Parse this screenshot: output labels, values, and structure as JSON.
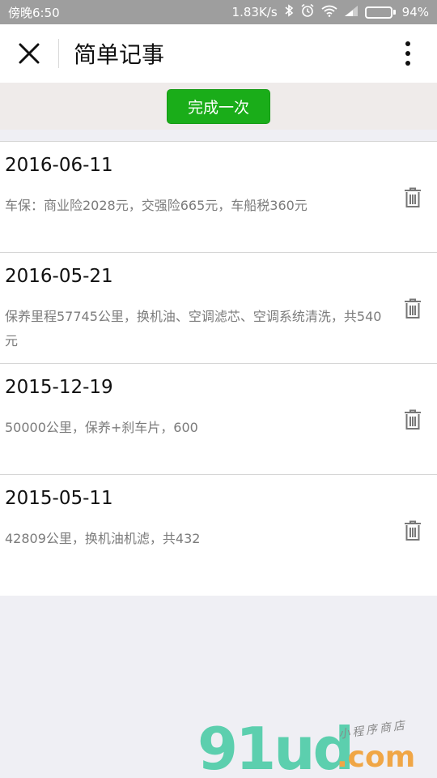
{
  "status_bar": {
    "time": "傍晚6:50",
    "speed": "1.83K/s",
    "battery": "94%",
    "battery_level": 0.94,
    "icons": [
      "bluetooth-icon",
      "alarm-icon",
      "wifi-icon",
      "signal-icon",
      "battery-icon"
    ]
  },
  "nav": {
    "title": "简单记事",
    "close_icon": "close-icon",
    "more_icon": "more-vertical-icon"
  },
  "action": {
    "button_label": "完成一次",
    "button_color": "#1aad19"
  },
  "records": [
    {
      "date": "2016-06-11",
      "desc": "车保：商业险2028元，交强险665元，车船税360元"
    },
    {
      "date": "2016-05-21",
      "desc": "保养里程57745公里，换机油、空调滤芯、空调系统清洗，共540元"
    },
    {
      "date": "2015-12-19",
      "desc": "50000公里，保养+刹车片，600"
    },
    {
      "date": "2015-05-11",
      "desc": "42809公里，换机油机滤，共432"
    }
  ],
  "watermark": {
    "main": "91ud",
    "suffix": ".com",
    "tagline": "小程序商店"
  }
}
